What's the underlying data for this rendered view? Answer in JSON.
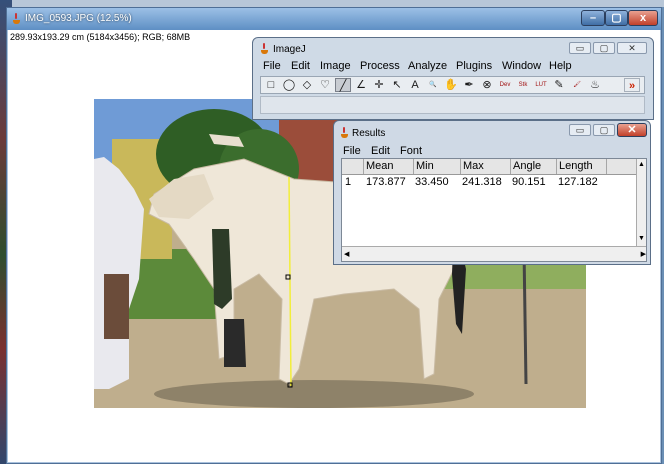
{
  "main_window": {
    "title": "IMG_0593.JPG (12.5%)",
    "info": "289.93x193.29 cm (5184x3456); RGB; 68MB",
    "controls": {
      "minimize": "–",
      "maximize": "▢",
      "close": "x"
    }
  },
  "imagej_window": {
    "title": "ImageJ",
    "controls": {
      "minimize": "▭",
      "maximize": "▢",
      "close": "✕"
    },
    "menu": [
      "File",
      "Edit",
      "Image",
      "Process",
      "Analyze",
      "Plugins",
      "Window",
      "Help"
    ],
    "tools": [
      {
        "icon": "rectangle-tool-icon",
        "glyph": "□"
      },
      {
        "icon": "oval-tool-icon",
        "glyph": "◯"
      },
      {
        "icon": "polygon-tool-icon",
        "glyph": "◇"
      },
      {
        "icon": "freehand-tool-icon",
        "glyph": "♡"
      },
      {
        "icon": "straight-line-tool-icon",
        "glyph": "╱"
      },
      {
        "icon": "angle-tool-icon",
        "glyph": "∠"
      },
      {
        "icon": "point-tool-icon",
        "glyph": "✛"
      },
      {
        "icon": "wand-tool-icon",
        "glyph": "↖"
      },
      {
        "icon": "text-tool-icon",
        "glyph": "A"
      },
      {
        "icon": "magnifier-tool-icon",
        "glyph": "🔍"
      },
      {
        "icon": "hand-tool-icon",
        "glyph": "✋"
      },
      {
        "icon": "dropper-tool-icon",
        "glyph": "✒"
      },
      {
        "icon": "stop-tool-icon",
        "glyph": "⊗"
      },
      {
        "icon": "developer-menu-icon",
        "glyph": "Dev"
      },
      {
        "icon": "stacks-menu-icon",
        "glyph": "Stk"
      },
      {
        "icon": "lut-menu-icon",
        "glyph": "LUT"
      },
      {
        "icon": "pencil-tool-icon",
        "glyph": "✎"
      },
      {
        "icon": "brush-tool-icon",
        "glyph": "🖌"
      },
      {
        "icon": "flood-fill-tool-icon",
        "glyph": "♨"
      },
      {
        "icon": "more-tools-icon",
        "glyph": "»"
      }
    ],
    "active_tool": 4
  },
  "results_window": {
    "title": "Results",
    "controls": {
      "minimize": "▭",
      "maximize": "▢",
      "close": "✕"
    },
    "menu": [
      "File",
      "Edit",
      "Font"
    ],
    "columns": [
      "",
      "Mean",
      "Min",
      "Max",
      "Angle",
      "Length"
    ],
    "rows": [
      [
        "1",
        "173.877",
        "33.450",
        "241.318",
        "90.151",
        "127.182"
      ]
    ]
  },
  "colors": {
    "title_gradient_top": "#9cc0e6",
    "title_gradient_bottom": "#5e8fc4",
    "close_button": "#c2402a",
    "measurement_line": "#f2ee3a",
    "more_tools_accent": "#cc2200"
  }
}
